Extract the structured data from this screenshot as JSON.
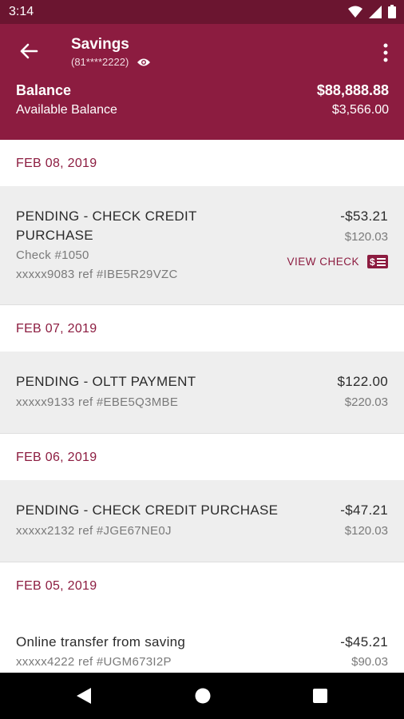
{
  "status_bar": {
    "time": "3:14"
  },
  "header": {
    "title": "Savings",
    "account_masked": "(81****2222)",
    "balance_label": "Balance",
    "balance_value": "$88,888.88",
    "available_label": "Available Balance",
    "available_value": "$3,566.00"
  },
  "groups": [
    {
      "date": "FEB 08, 2019",
      "transactions": [
        {
          "description_line1": "PENDING - CHECK CREDIT",
          "description_line2": "PURCHASE",
          "check_number": "Check #1050",
          "ref": "xxxxx9083 ref #IBE5R29VZC",
          "amount": "-$53.21",
          "running_balance": "$120.03",
          "action_label": "VIEW CHECK"
        }
      ]
    },
    {
      "date": "FEB 07, 2019",
      "transactions": [
        {
          "description": "PENDING - OLTT PAYMENT",
          "ref": "xxxxx9133 ref #EBE5Q3MBE",
          "amount": "$122.00",
          "running_balance": "$220.03"
        }
      ]
    },
    {
      "date": "FEB 06, 2019",
      "transactions": [
        {
          "description": "PENDING - CHECK CREDIT PURCHASE",
          "ref": "xxxxx2132 ref #JGE67NE0J",
          "amount": "-$47.21",
          "running_balance": "$120.03"
        }
      ]
    },
    {
      "date": "FEB 05, 2019",
      "transactions": [
        {
          "description": "Online transfer from saving",
          "ref": "xxxxx4222 ref #UGM673I2P",
          "amount": "-$45.21",
          "running_balance": "$90.03"
        }
      ]
    }
  ],
  "colors": {
    "primary": "#8c1c40",
    "status_bar": "#6b1530",
    "row_gray": "#eeeeee"
  },
  "icons": [
    "back-arrow-icon",
    "eye-icon",
    "more-vert-icon",
    "check-icon",
    "wifi-icon",
    "signal-icon",
    "battery-icon",
    "nav-back-icon",
    "nav-home-icon",
    "nav-recents-icon"
  ]
}
